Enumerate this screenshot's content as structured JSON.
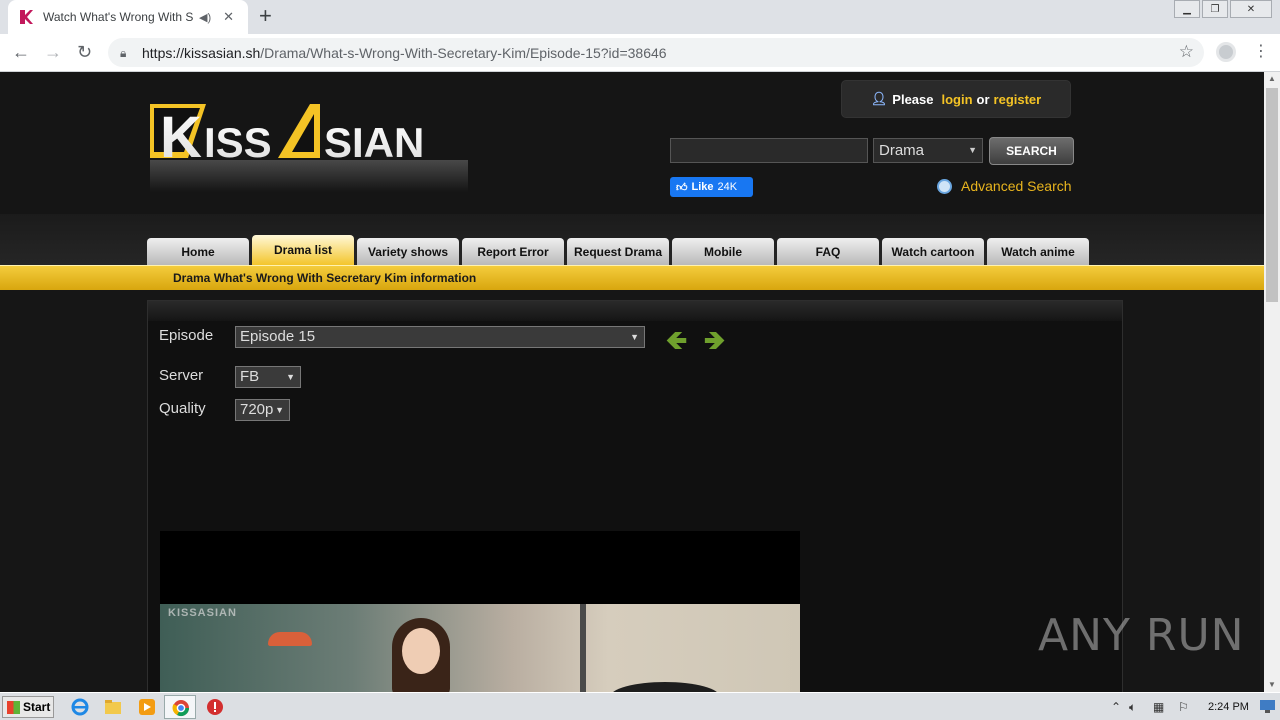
{
  "browser": {
    "tab_title": "Watch What's Wrong With Secretary Kim",
    "url_host": "https://kissasian.sh",
    "url_path": "/Drama/What-s-Wrong-With-Secretary-Kim/Episode-15?id=38646"
  },
  "site": {
    "logo_text": "KISSASIAN",
    "login": {
      "prefix": "Please",
      "login": "login",
      "or": "or",
      "register": "register"
    },
    "search": {
      "category": "Drama",
      "button": "SEARCH"
    },
    "fb": {
      "like": "Like",
      "count": "24K"
    },
    "advanced_search": "Advanced Search",
    "nav": [
      "Home",
      "Drama list",
      "Variety shows",
      "Report Error",
      "Request Drama",
      "Mobile",
      "FAQ",
      "Watch cartoon",
      "Watch anime"
    ],
    "active_nav": "Drama list",
    "info_bar": "Drama What's Wrong With Secretary Kim information"
  },
  "player": {
    "episode_label": "Episode",
    "episode_value": "Episode 15",
    "server_label": "Server",
    "server_value": "FB",
    "quality_label": "Quality",
    "quality_value": "720p",
    "watermark": "KISSASIAN"
  },
  "overlay_watermark": "ANY RUN",
  "taskbar": {
    "start": "Start",
    "clock": "2:24 PM"
  },
  "colors": {
    "accent_yellow": "#f4c325",
    "nav_active": "#f3c52b",
    "arrow_green": "#6fa02d"
  }
}
